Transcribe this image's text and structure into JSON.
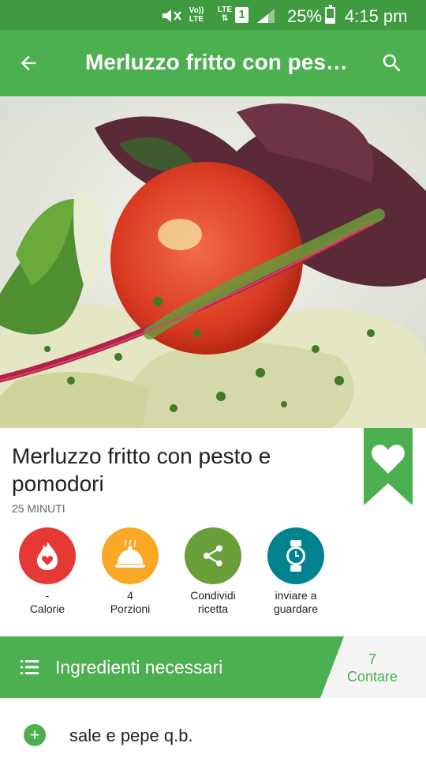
{
  "status_bar": {
    "volte": "Vo))",
    "lte_label": "LTE",
    "lte1": "LTE",
    "sim": "1",
    "battery": "25%",
    "time": "4:15 pm"
  },
  "toolbar": {
    "title": "Merluzzo fritto con pesto e pomodori",
    "back_icon": "arrow-left-icon",
    "search_icon": "search-icon"
  },
  "recipe": {
    "title": "Merluzzo fritto con pesto e pomodori",
    "time": "25 MINUTI",
    "favorite_icon": "heart-icon"
  },
  "actions": [
    {
      "value": "-",
      "label": "Calorie",
      "color": "#e53935",
      "icon": "flame-heart-icon"
    },
    {
      "value": "4",
      "label": "Porzioni",
      "color": "#f9a825",
      "icon": "serving-dish-icon"
    },
    {
      "value": "",
      "label": "Condividi ricetta",
      "color": "#689f38",
      "icon": "share-icon"
    },
    {
      "value": "",
      "label": "inviare a guardare",
      "color": "#00838f",
      "icon": "watch-icon"
    }
  ],
  "ingredients": {
    "header": "Ingredienti necessari",
    "count": "7",
    "count_label": "Contare",
    "items": [
      "sale e pepe q.b."
    ]
  },
  "colors": {
    "primary": "#4caf50",
    "status_bar": "#3f9a40"
  }
}
